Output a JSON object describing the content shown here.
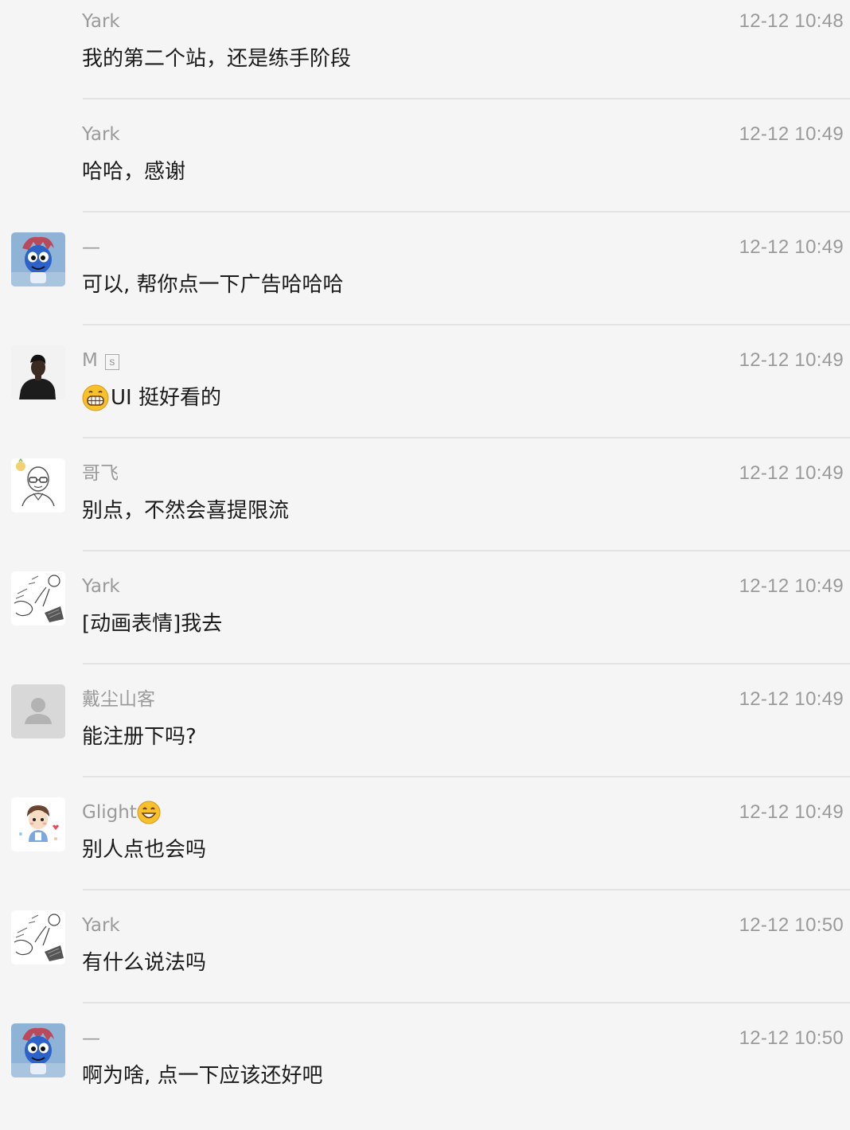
{
  "messages": [
    {
      "sender": "Yark",
      "time": "12-12 10:48",
      "text": "我的第二个站，还是练手阶段",
      "avatar": "none"
    },
    {
      "sender": "Yark",
      "time": "12-12 10:49",
      "text": "哈哈，感谢",
      "avatar": "none"
    },
    {
      "sender": "—",
      "time": "12-12 10:49",
      "text": "可以, 帮你点一下广告哈哈哈",
      "avatar": "blue-character-avatar"
    },
    {
      "sender": "M",
      "sender_badge": "s",
      "time": "12-12 10:49",
      "text": "UI 挺好看的",
      "body_emoji": "grinning-face-emoji",
      "avatar": "dark-silhouette-avatar"
    },
    {
      "sender": "哥飞",
      "time": "12-12 10:49",
      "text": "别点，不然会喜提限流",
      "avatar": "sketch-glasses-avatar"
    },
    {
      "sender": "Yark",
      "time": "12-12 10:49",
      "text": "[动画表情]我去",
      "avatar": "sketch-drawing-avatar"
    },
    {
      "sender": "戴尘山客",
      "time": "12-12 10:49",
      "text": "能注册下吗?",
      "avatar": "default-user-avatar"
    },
    {
      "sender": "Glight",
      "sender_emoji": "smiling-face-emoji",
      "time": "12-12 10:49",
      "text": "别人点也会吗",
      "avatar": "cartoon-boy-avatar"
    },
    {
      "sender": "Yark",
      "time": "12-12 10:50",
      "text": "有什么说法吗",
      "avatar": "sketch-drawing-avatar"
    },
    {
      "sender": "—",
      "time": "12-12 10:50",
      "text": "啊为啥, 点一下应该还好吧",
      "avatar": "blue-character-avatar"
    }
  ],
  "colors": {
    "background": "#f5f5f5",
    "sender": "#9a9a9a",
    "time": "#9a9a9a",
    "message_text": "#1a1a1a",
    "divider": "#e3e3e3"
  }
}
